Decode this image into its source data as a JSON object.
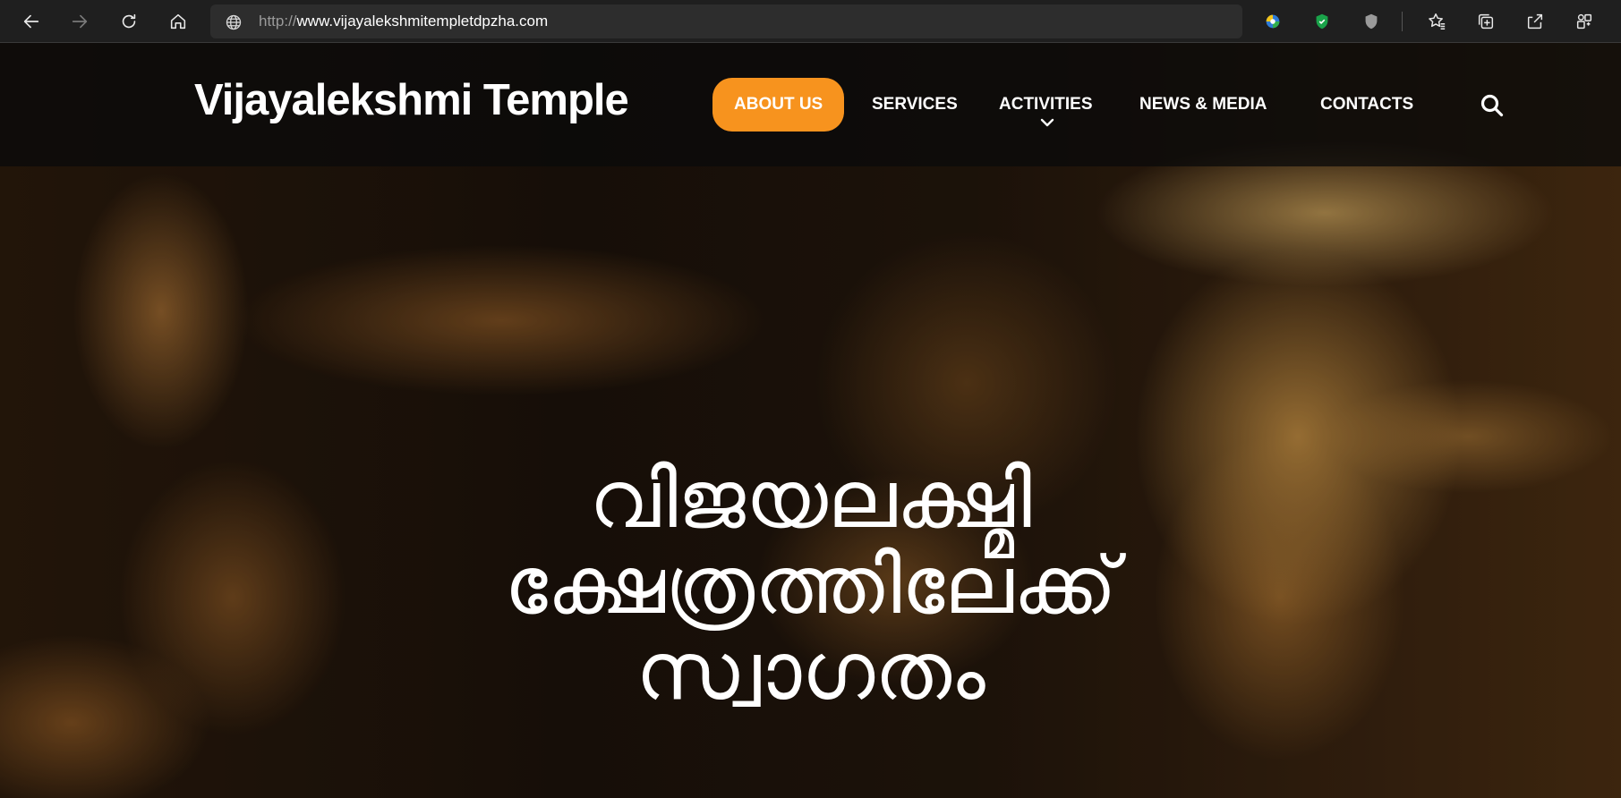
{
  "browser": {
    "url_protocol": "http://",
    "url_host": "www.vijayalekshmitempletdpzha.com",
    "nav_icons": [
      "back-arrow-icon",
      "forward-arrow-icon",
      "refresh-icon",
      "home-icon"
    ],
    "extension_icons": [
      "color-orb-icon",
      "green-shield-icon",
      "gray-shield-icon",
      "favorites-star-icon",
      "collections-icon",
      "share-icon",
      "extensions-icon"
    ]
  },
  "site": {
    "logo": "Vijayalekshmi Temple",
    "nav": {
      "about": "ABOUT US",
      "services": "SERVICES",
      "activities": "ACTIVITIES",
      "news": "NEWS & MEDIA",
      "contacts": "CONTACTS"
    },
    "accent_color": "#f7931e"
  },
  "hero": {
    "line1": "വിജയലക്ഷ്മി",
    "line2": "ക്ഷേത്രത്തിലേക്ക്",
    "line3": "സ്വാഗതം"
  }
}
